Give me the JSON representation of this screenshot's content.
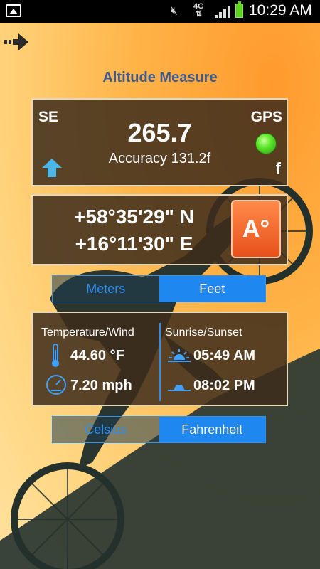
{
  "status_bar": {
    "network": "4G",
    "time": "10:29 AM"
  },
  "header": {
    "title": "Altitude Measure"
  },
  "altitude_panel": {
    "direction": "SE",
    "gps_label": "GPS",
    "gps_status_color": "#5ce62a",
    "altitude": "265.7",
    "accuracy": "Accuracy 131.2f",
    "unit": "f"
  },
  "coordinates": {
    "latitude": "+58°35'29\" N",
    "longitude": "+16°11'30\" E",
    "mode_button": "A°"
  },
  "unit_toggle": {
    "left": "Meters",
    "right": "Feet",
    "selected": "Feet"
  },
  "weather": {
    "temp_wind_heading": "Temperature/Wind",
    "temperature": "44.60 °F",
    "wind": "7.20 mph",
    "sun_heading": "Sunrise/Sunset",
    "sunrise": "05:49 AM",
    "sunset": "08:02 PM"
  },
  "temp_toggle": {
    "left": "Celsius",
    "right": "Fahrenheit",
    "selected": "Fahrenheit"
  },
  "colors": {
    "accent_blue": "#1e88f0",
    "title_blue": "#3e5a8f",
    "a_button": "#e8501c"
  }
}
